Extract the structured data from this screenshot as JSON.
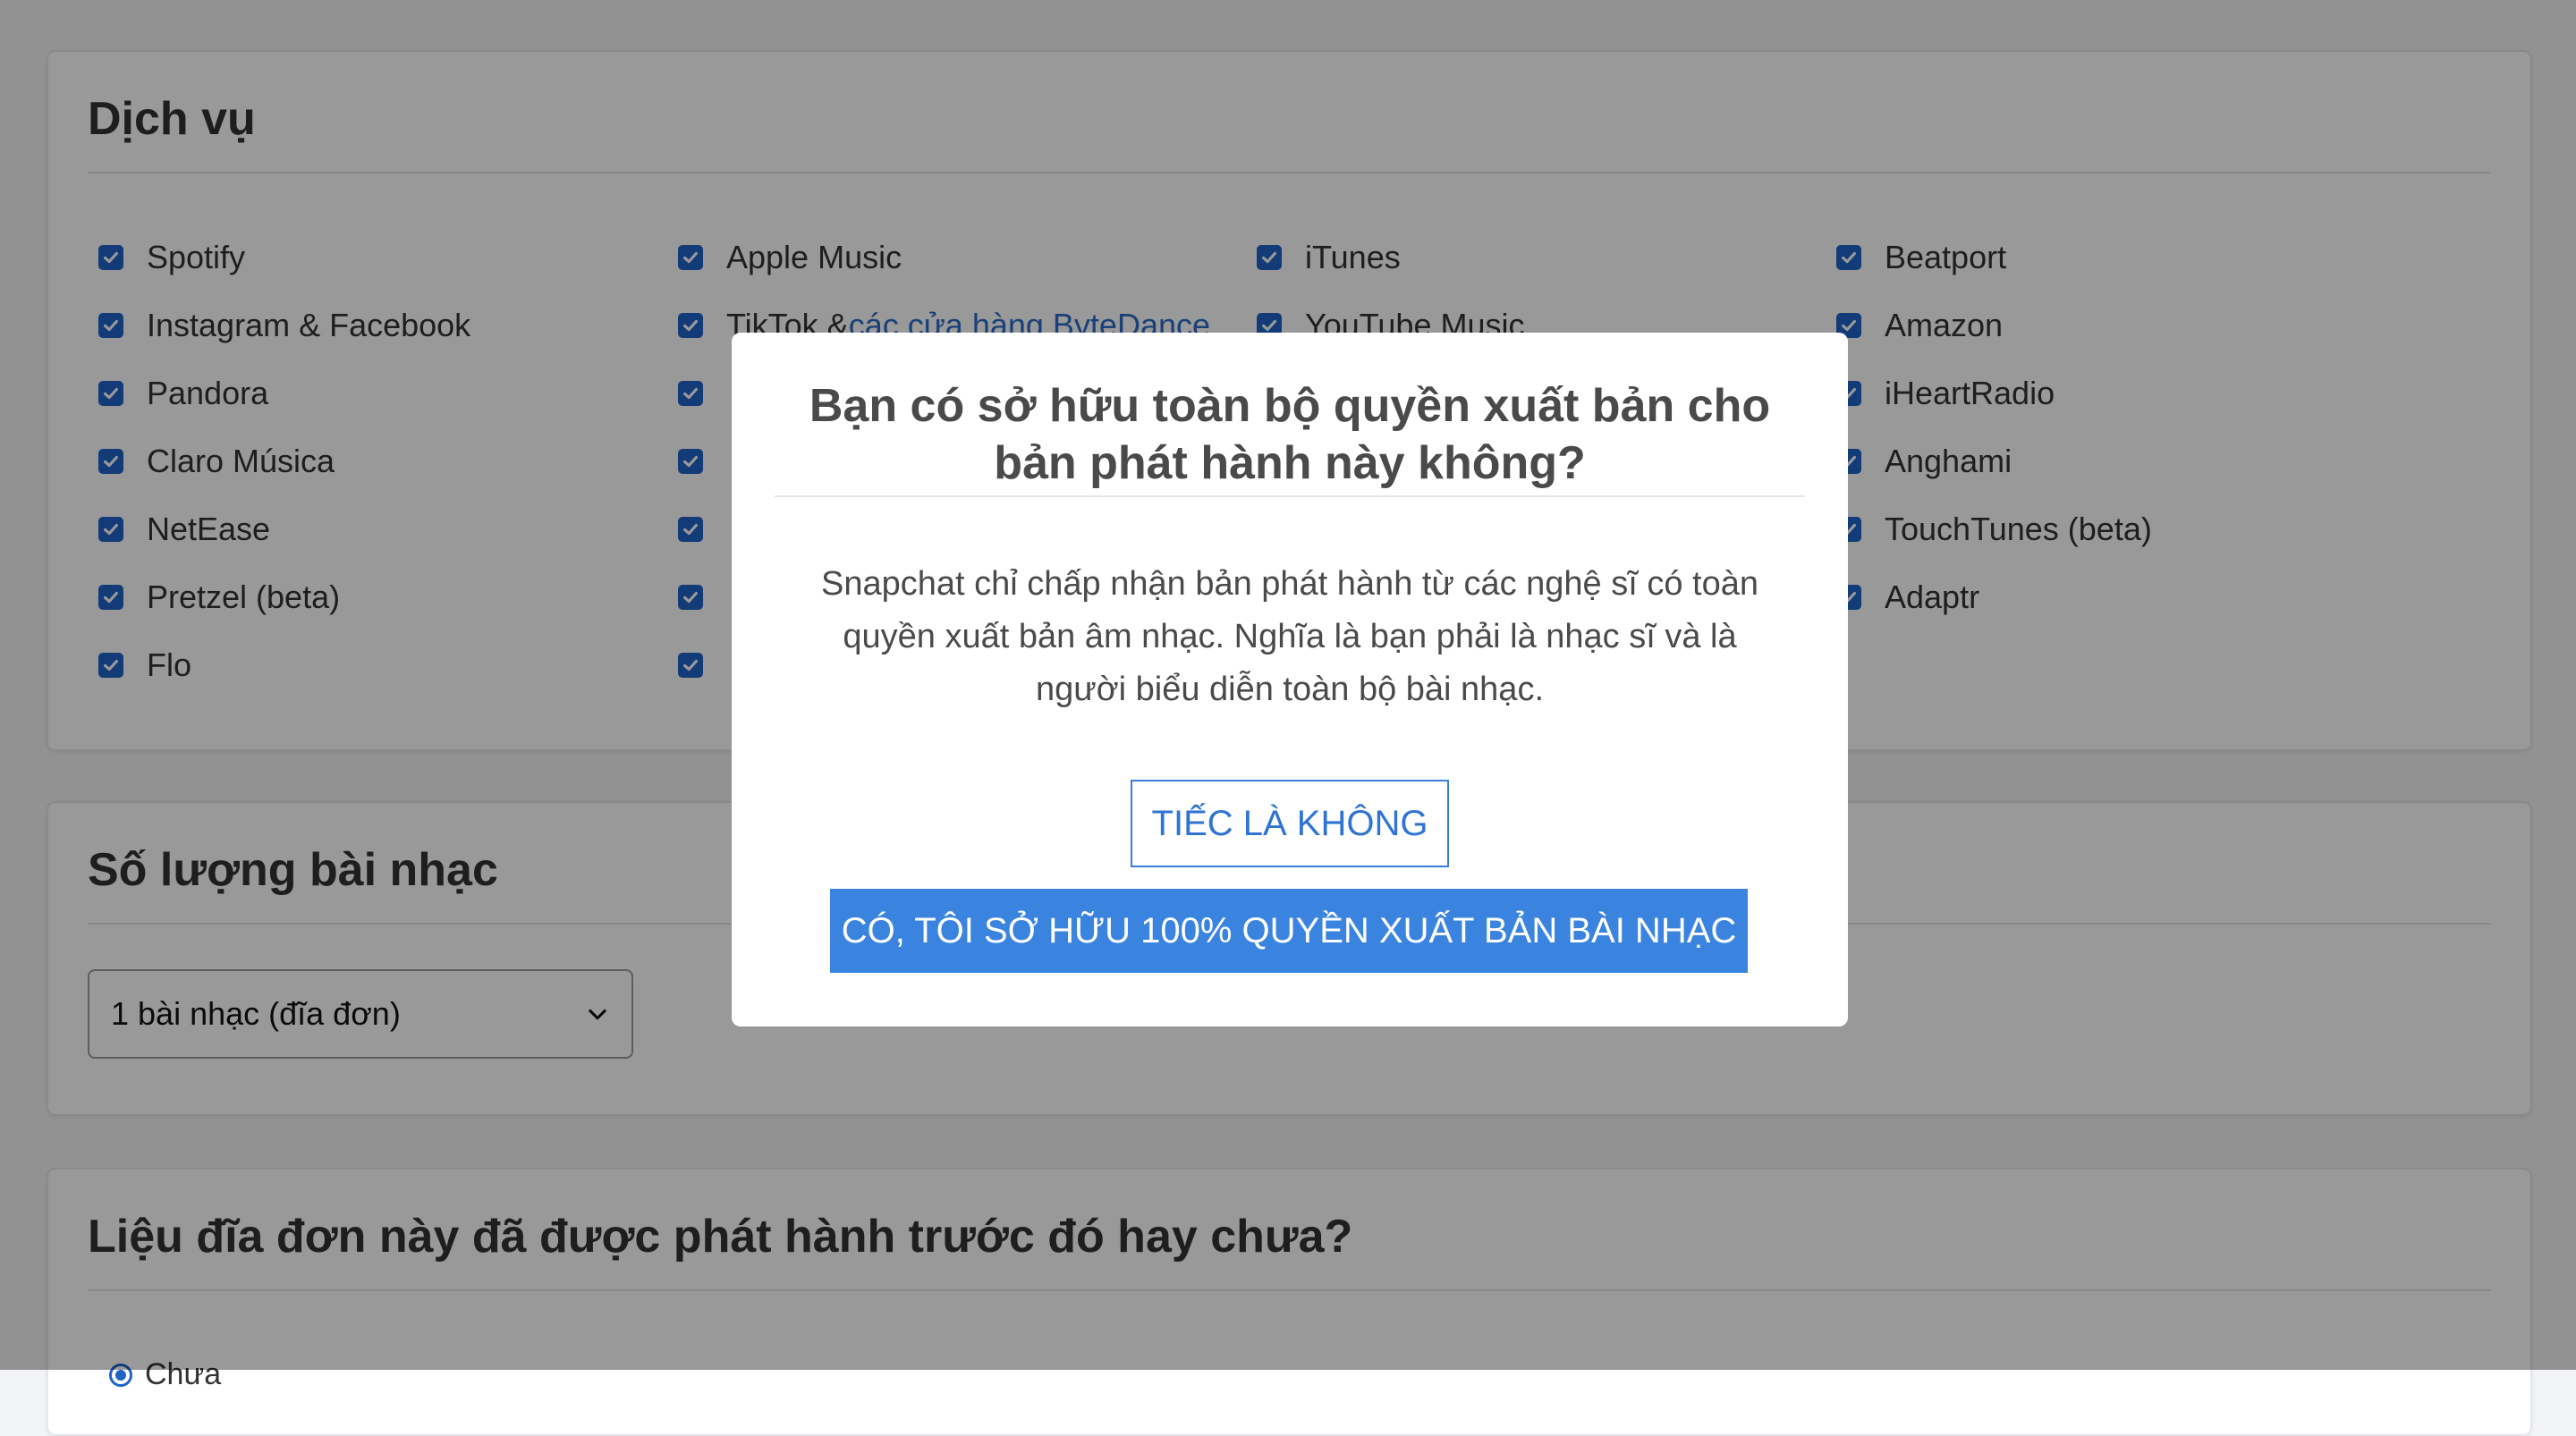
{
  "services": {
    "title": "Dịch vụ",
    "columns": [
      [
        {
          "label": "Spotify",
          "checked": true
        },
        {
          "label": "Instagram & Facebook",
          "checked": true
        },
        {
          "label": "Pandora",
          "checked": true
        },
        {
          "label": "Claro Música",
          "checked": true
        },
        {
          "label": "NetEase",
          "checked": true
        },
        {
          "label": "Pretzel (beta)",
          "checked": true
        },
        {
          "label": "Flo",
          "checked": true
        }
      ],
      [
        {
          "label": "Apple Music",
          "checked": true
        },
        {
          "label": "TikTok & ",
          "link": "các cửa hàng ByteDance",
          "checked": true
        },
        {
          "label": "",
          "checked": true
        },
        {
          "label": "",
          "checked": true
        },
        {
          "label": "",
          "checked": true
        },
        {
          "label": "",
          "checked": true
        },
        {
          "label": "",
          "checked": true
        }
      ],
      [
        {
          "label": "iTunes",
          "checked": true
        },
        {
          "label": "YouTube Music",
          "checked": true
        }
      ],
      [
        {
          "label": "Beatport",
          "checked": true
        },
        {
          "label": "Amazon",
          "checked": true
        },
        {
          "label": "iHeartRadio",
          "checked": true
        },
        {
          "label": "Anghami",
          "checked": true
        },
        {
          "label": "TouchTunes (beta)",
          "checked": true
        },
        {
          "label": "Adaptr",
          "checked": true
        }
      ]
    ]
  },
  "track_count": {
    "title": "Số lượng bài nhạc",
    "selected": "1 bài nhạc (đĩa đơn)"
  },
  "released_before": {
    "title": "Liệu đĩa đơn này đã được phát hành trước đó hay chưa?",
    "option_label": "Chưa"
  },
  "modal": {
    "title": "Bạn có sở hữu toàn bộ quyền xuất bản cho bản phát hành này không?",
    "body": "Snapchat chỉ chấp nhận bản phát hành từ các nghệ sĩ có toàn quyền xuất bản âm nhạc. Nghĩa là bạn phải là nhạc sĩ và là người biểu diễn toàn bộ bài nhạc.",
    "no_label": "TIẾC LÀ KHÔNG",
    "yes_label": "CÓ, TÔI SỞ HỮU 100% QUYỀN XUẤT BẢN BÀI NHẠC"
  },
  "colors": {
    "accent": "#3a84df",
    "checkbox": "#1f63c6",
    "link": "#2a6bc8"
  }
}
